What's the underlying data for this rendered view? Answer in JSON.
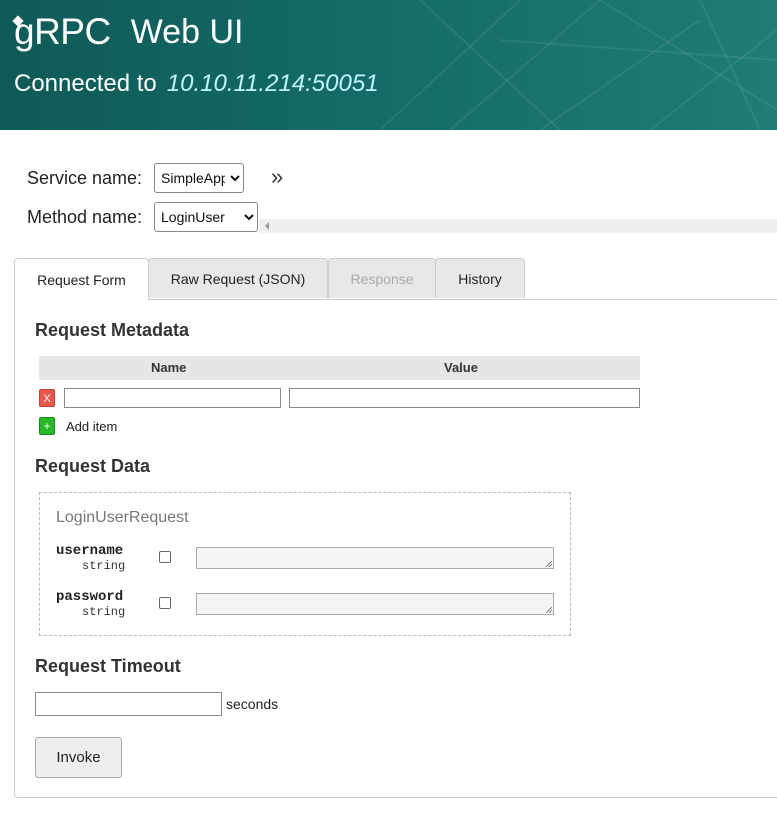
{
  "header": {
    "logo_text": "gRPC",
    "title": "Web UI",
    "connected_label": "Connected to",
    "address": "10.10.11.214:50051"
  },
  "selectors": {
    "service_label": "Service name:",
    "service_value": "SimpleApp",
    "method_label": "Method name:",
    "method_value": "LoginUser",
    "expand_glyph": "»"
  },
  "tabs": [
    {
      "label": "Request Form",
      "state": "active"
    },
    {
      "label": "Raw Request (JSON)",
      "state": "normal"
    },
    {
      "label": "Response",
      "state": "disabled"
    },
    {
      "label": "History",
      "state": "normal"
    }
  ],
  "metadata": {
    "heading": "Request Metadata",
    "col_name": "Name",
    "col_value": "Value",
    "remove_label": "X",
    "add_glyph": "+",
    "add_label": "Add item"
  },
  "request_data": {
    "heading": "Request Data",
    "message_name": "LoginUserRequest",
    "fields": [
      {
        "name": "username",
        "type": "string"
      },
      {
        "name": "password",
        "type": "string"
      }
    ]
  },
  "timeout": {
    "heading": "Request Timeout",
    "unit": "seconds"
  },
  "invoke_label": "Invoke"
}
